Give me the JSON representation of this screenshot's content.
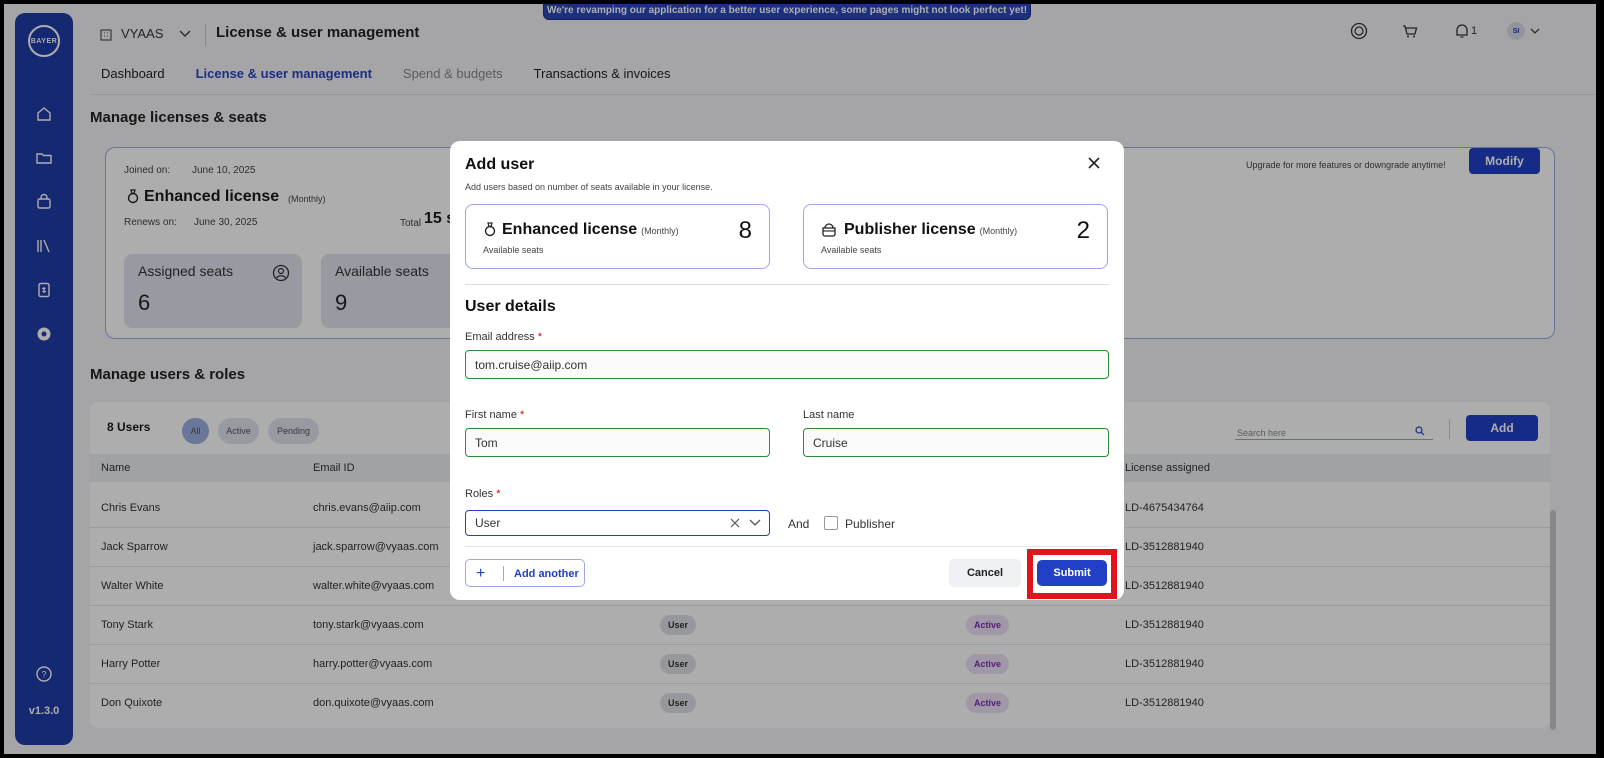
{
  "banner": "We're revamping our application for a better user experience, some pages might not look perfect yet!",
  "header": {
    "org": "VYAAS",
    "title": "License & user management",
    "notification_count": "1",
    "avatar_initials": "SI"
  },
  "tabs": [
    {
      "label": "Dashboard"
    },
    {
      "label": "License & user management"
    },
    {
      "label": "Spend & budgets"
    },
    {
      "label": "Transactions & invoices"
    }
  ],
  "sidebar": {
    "logo": "BAYER",
    "version": "v1.3.0",
    "icons": [
      "home-icon",
      "folder-icon",
      "bag-icon",
      "library-icon",
      "document-dollar-icon",
      "settings-icon",
      "help-icon"
    ]
  },
  "licenses_section": {
    "title": "Manage licenses & seats",
    "joined_label": "Joined on:",
    "joined_date": "June 10, 2025",
    "license_name": "Enhanced license",
    "license_period": "(Monthly)",
    "renews_label": "Renews on:",
    "renews_date": "June 30, 2025",
    "total_label": "Total",
    "total_value": "15 s",
    "assigned_label": "Assigned seats",
    "assigned_value": "6",
    "available_label": "Available seats",
    "available_value": "9",
    "upgrade_text": "Upgrade for more features or downgrade anytime!",
    "modify_label": "Modify"
  },
  "users_section": {
    "title": "Manage users & roles",
    "count_label": "8 Users",
    "filters": [
      "All",
      "Active",
      "Pending"
    ],
    "search_placeholder": "Search here",
    "add_label": "Add",
    "columns": [
      "Name",
      "Email ID",
      "License assigned"
    ],
    "rows": [
      {
        "name": "Chris Evans",
        "email": "chris.evans@aiip.com",
        "role": "",
        "status": "",
        "license": "LD-4675434764"
      },
      {
        "name": "Jack Sparrow",
        "email": "jack.sparrow@vyaas.com",
        "role": "",
        "status": "",
        "license": "LD-3512881940"
      },
      {
        "name": "Walter White",
        "email": "walter.white@vyaas.com",
        "role": "",
        "status": "",
        "license": "LD-3512881940"
      },
      {
        "name": "Tony Stark",
        "email": "tony.stark@vyaas.com",
        "role": "User",
        "status": "Active",
        "license": "LD-3512881940"
      },
      {
        "name": "Harry Potter",
        "email": "harry.potter@vyaas.com",
        "role": "User",
        "status": "Active",
        "license": "LD-3512881940"
      },
      {
        "name": "Don Quixote",
        "email": "don.quixote@vyaas.com",
        "role": "User",
        "status": "Active",
        "license": "LD-3512881940"
      }
    ]
  },
  "modal": {
    "title": "Add user",
    "subtitle": "Add users based on number of seats available in your license.",
    "licenses": [
      {
        "name": "Enhanced license",
        "period": "(Monthly)",
        "count": "8",
        "sub": "Available seats"
      },
      {
        "name": "Publisher license",
        "period": "(Monthly)",
        "count": "2",
        "sub": "Available seats"
      }
    ],
    "details_title": "User details",
    "email_label": "Email address",
    "email_value": "tom.cruise@aiip.com",
    "first_name_label": "First name",
    "first_name_value": "Tom",
    "last_name_label": "Last name",
    "last_name_value": "Cruise",
    "roles_label": "Roles",
    "role_value": "User",
    "and_label": "And",
    "publisher_label": "Publisher",
    "add_another_label": "Add another",
    "cancel_label": "Cancel",
    "submit_label": "Submit",
    "required_mark": "*"
  }
}
